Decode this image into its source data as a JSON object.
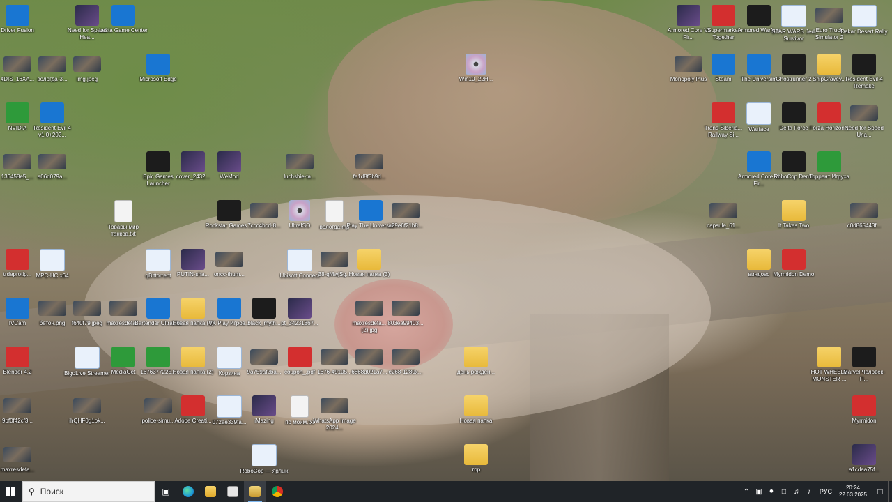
{
  "desktop": {
    "icons": [
      {
        "label": "Driver Fusion",
        "icon": "driver-fusion-icon",
        "kind": "blue"
      },
      {
        "label": "Need for Speed Hea...",
        "icon": "game-icon",
        "kind": "game"
      },
      {
        "label": "Lesta Game Center",
        "icon": "lesta-icon",
        "kind": "blue"
      },
      {
        "label": "4DIS_16XA...",
        "icon": "image-icon",
        "kind": "photo"
      },
      {
        "label": "вологда-3...",
        "icon": "image-icon",
        "kind": "photo"
      },
      {
        "label": "img.jpeg",
        "icon": "image-icon",
        "kind": "photo"
      },
      {
        "label": "Microsoft Edge",
        "icon": "edge-icon",
        "kind": "blue"
      },
      {
        "label": "Win10_22H...",
        "icon": "disc-image-icon",
        "kind": "disc"
      },
      {
        "label": "NVIDIA",
        "icon": "nvidia-icon",
        "kind": "green"
      },
      {
        "label": "Resident Evil 4 v1.0+202...",
        "icon": "globe-shortcut-icon",
        "kind": "blue"
      },
      {
        "label": "136458e5_...",
        "icon": "image-icon",
        "kind": "photo"
      },
      {
        "label": "a06d079a...",
        "icon": "image-icon",
        "kind": "photo"
      },
      {
        "label": "Epic Games Launcher",
        "icon": "epic-games-icon",
        "kind": "dark"
      },
      {
        "label": "cover_2432...",
        "icon": "image-icon",
        "kind": "game"
      },
      {
        "label": "WeMod",
        "icon": "wemod-icon",
        "kind": "game"
      },
      {
        "label": "luchshie-ta...",
        "icon": "image-icon",
        "kind": "photo"
      },
      {
        "label": "fe1d8f3b9d...",
        "icon": "image-icon",
        "kind": "photo"
      },
      {
        "label": "Товары мир танков.txt",
        "icon": "text-file-icon",
        "kind": "doc"
      },
      {
        "label": "Rockstar Games ...",
        "icon": "rockstar-icon",
        "kind": "dark"
      },
      {
        "label": "7ccc4bcd-8...",
        "icon": "image-icon",
        "kind": "photo"
      },
      {
        "label": "UltraISO",
        "icon": "ultraiso-icon",
        "kind": "disc"
      },
      {
        "label": "вологда.mp",
        "icon": "file-icon",
        "kind": "doc"
      },
      {
        "label": "Play The Universim",
        "icon": "wemod-icon",
        "kind": "blue"
      },
      {
        "label": "a29e6f21b8...",
        "icon": "image-icon",
        "kind": "photo"
      },
      {
        "label": "trdeprotip...",
        "icon": "file-icon",
        "kind": "red"
      },
      {
        "label": "MPC-HC x64",
        "icon": "mpc-hc-icon",
        "kind": "win"
      },
      {
        "label": "qBittorrent",
        "icon": "window-icon",
        "kind": "win"
      },
      {
        "label": "PUTIN-sha...",
        "icon": "image-icon",
        "kind": "game"
      },
      {
        "label": "oncc-thum...",
        "icon": "image-icon",
        "kind": "photo"
      },
      {
        "label": "Ubisoft Connect",
        "icon": "ubisoft-icon",
        "kind": "win"
      },
      {
        "label": "38-qMwjSg...",
        "icon": "image-icon",
        "kind": "photo"
      },
      {
        "label": "Новая папка (3)",
        "icon": "archive-icon",
        "kind": "folder"
      },
      {
        "label": "IVCam",
        "icon": "camera-icon",
        "kind": "blue"
      },
      {
        "label": "бетон.png",
        "icon": "image-icon",
        "kind": "photo"
      },
      {
        "label": "f640f79.jpeg",
        "icon": "image-icon",
        "kind": "photo"
      },
      {
        "label": "maxresdefa...",
        "icon": "image-icon",
        "kind": "photo"
      },
      {
        "label": "Bartender UltraLite",
        "icon": "bartender-icon",
        "kind": "blue"
      },
      {
        "label": "Новая папка (4)",
        "icon": "archive-icon",
        "kind": "folder"
      },
      {
        "label": "VK Play Игров...",
        "icon": "vk-play-icon",
        "kind": "blue"
      },
      {
        "label": "black_myth...",
        "icon": "image-icon",
        "kind": "dark"
      },
      {
        "label": "pt_34231867...",
        "icon": "image-icon",
        "kind": "game"
      },
      {
        "label": "maxresdefa... (2).jpg",
        "icon": "image-icon",
        "kind": "photo"
      },
      {
        "label": "803ea99403...",
        "icon": "image-icon",
        "kind": "photo"
      },
      {
        "label": "Blender 4.2",
        "icon": "blender-icon",
        "kind": "red"
      },
      {
        "label": "BigoLive Streamer",
        "icon": "bigolive-icon",
        "kind": "win"
      },
      {
        "label": "MediaGet",
        "icon": "mediaget-icon",
        "kind": "green"
      },
      {
        "label": "1676377225...",
        "icon": "image-icon",
        "kind": "green"
      },
      {
        "label": "Новая папка (2)",
        "icon": "folder-icon",
        "kind": "folder"
      },
      {
        "label": "Корзина",
        "icon": "recycle-bin-icon",
        "kind": "win"
      },
      {
        "label": "9a759af2ba...",
        "icon": "image-icon",
        "kind": "photo"
      },
      {
        "label": "coupon_.pdf",
        "icon": "pdf-icon",
        "kind": "red"
      },
      {
        "label": "1676-49105...",
        "icon": "image-icon",
        "kind": "photo"
      },
      {
        "label": "6868d021a7...",
        "icon": "image-icon",
        "kind": "photo"
      },
      {
        "label": "e268-1280x...",
        "icon": "image-icon",
        "kind": "photo"
      },
      {
        "label": "день рожден...",
        "icon": "archive-icon",
        "kind": "folder"
      },
      {
        "label": "9bf0f42cf3...",
        "icon": "image-icon",
        "kind": "photo"
      },
      {
        "label": "ihQHF0g1ok...",
        "icon": "image-icon",
        "kind": "photo"
      },
      {
        "label": "police-simu...",
        "icon": "image-icon",
        "kind": "photo"
      },
      {
        "label": "Adobe Creati...",
        "icon": "adobe-cc-icon",
        "kind": "red"
      },
      {
        "label": "072ae339fa...",
        "icon": "image-icon",
        "kind": "win"
      },
      {
        "label": "iMazing",
        "icon": "imazing-icon",
        "kind": "game"
      },
      {
        "label": "по моим.txt",
        "icon": "text-file-icon",
        "kind": "doc"
      },
      {
        "label": "WhatsApp Image 2024...",
        "icon": "image-icon",
        "kind": "photo"
      },
      {
        "label": "Новая папка",
        "icon": "archive-icon",
        "kind": "folder"
      },
      {
        "label": "maxresdefa...",
        "icon": "image-icon",
        "kind": "photo"
      },
      {
        "label": "RoboCop — ярлык",
        "icon": "window-icon",
        "kind": "win"
      },
      {
        "label": "тор",
        "icon": "archive-icon",
        "kind": "folder"
      },
      {
        "label": "Armored Core VI Fir...",
        "icon": "game-icon",
        "kind": "game"
      },
      {
        "label": "Supermarket Together",
        "icon": "game-icon",
        "kind": "red"
      },
      {
        "label": "Armored Warfare",
        "icon": "game-icon",
        "kind": "dark"
      },
      {
        "label": "STAR WARS Jedi Survivor",
        "icon": "window-icon",
        "kind": "win"
      },
      {
        "label": "Euro Truck Simulator 2",
        "icon": "game-icon",
        "kind": "photo"
      },
      {
        "label": "Dakar Desert Rally",
        "icon": "window-icon",
        "kind": "win"
      },
      {
        "label": "Monopoly Plus",
        "icon": "game-icon",
        "kind": "photo"
      },
      {
        "label": "Steam",
        "icon": "steam-icon",
        "kind": "blue"
      },
      {
        "label": "The Universim",
        "icon": "globe-shortcut-icon",
        "kind": "blue"
      },
      {
        "label": "Ghostrunner 2",
        "icon": "game-icon",
        "kind": "dark"
      },
      {
        "label": "ShipGravey...",
        "icon": "game-icon",
        "kind": "folder"
      },
      {
        "label": "Resident Evil 4 Remake",
        "icon": "game-icon",
        "kind": "dark"
      },
      {
        "label": "Trans-Siberia... Railway Si...",
        "icon": "game-icon",
        "kind": "red"
      },
      {
        "label": "Warface",
        "icon": "game-icon",
        "kind": "win"
      },
      {
        "label": "Delta Force",
        "icon": "game-icon",
        "kind": "dark"
      },
      {
        "label": "Forza Horizon...",
        "icon": "game-icon",
        "kind": "red"
      },
      {
        "label": "Need for Speed Una...",
        "icon": "game-icon",
        "kind": "photo"
      },
      {
        "label": "Armored Core VI Fir...",
        "icon": "globe-shortcut-icon",
        "kind": "blue"
      },
      {
        "label": "RoboCop Demo",
        "icon": "game-icon",
        "kind": "dark"
      },
      {
        "label": "Торрент Игруха",
        "icon": "torrent-icon",
        "kind": "green"
      },
      {
        "label": "capsule_61...",
        "icon": "image-icon",
        "kind": "photo"
      },
      {
        "label": "It Takes Two",
        "icon": "game-icon",
        "kind": "folder"
      },
      {
        "label": "c0d865443f...",
        "icon": "image-icon",
        "kind": "photo"
      },
      {
        "label": "виндовс",
        "icon": "archive-icon",
        "kind": "folder"
      },
      {
        "label": "Myrmidon Demo",
        "icon": "game-icon",
        "kind": "red"
      },
      {
        "label": "HOT WHEELS MONSTER ...",
        "icon": "game-icon",
        "kind": "folder"
      },
      {
        "label": "Marvel Человек-П...",
        "icon": "game-icon",
        "kind": "dark"
      },
      {
        "label": "Myrmidon",
        "icon": "game-icon",
        "kind": "red"
      },
      {
        "label": "a1cdaa75f...",
        "icon": "image-icon",
        "kind": "game"
      }
    ]
  },
  "taskbar": {
    "search_placeholder": "Поиск",
    "apps": [
      {
        "name": "task-view",
        "icon": "task-view-icon"
      },
      {
        "name": "edge",
        "icon": "edge-icon",
        "color": "#1f9bd6"
      },
      {
        "name": "file-explorer",
        "icon": "folder-icon",
        "color": "#f2c24a"
      },
      {
        "name": "store",
        "icon": "store-icon",
        "color": "#e6e6e6"
      },
      {
        "name": "active-app",
        "icon": "archive-icon",
        "color": "#d9b44a",
        "active": true
      },
      {
        "name": "chrome",
        "icon": "chrome-icon",
        "color": "#d93025"
      }
    ],
    "tray": {
      "language": "РУС",
      "time": "20:24",
      "date": "22.03.2025"
    }
  }
}
